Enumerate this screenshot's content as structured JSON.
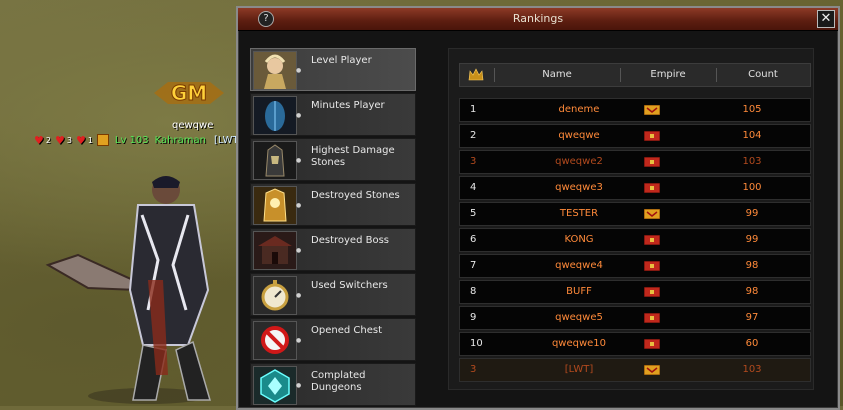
{
  "world": {
    "gm_badge": "GM",
    "player_name": "qewqwe",
    "hearts": [
      "2",
      "3",
      "1"
    ],
    "level_text": "Lv 103",
    "class_text": "Kahraman",
    "guild_text": "[LWT]"
  },
  "window": {
    "title": "Rankings",
    "help_label": "?",
    "close_label": "✕"
  },
  "categories": [
    {
      "label": "Level Player",
      "icon": "knight-portrait-icon",
      "active": true
    },
    {
      "label": "Minutes Player",
      "icon": "blue-feather-icon",
      "active": false
    },
    {
      "label": "Highest Damage Stones",
      "icon": "dark-stone-icon",
      "active": false
    },
    {
      "label": "Destroyed Stones",
      "icon": "golden-stone-icon",
      "active": false
    },
    {
      "label": "Destroyed Boss",
      "icon": "temple-icon",
      "active": false
    },
    {
      "label": "Used Switchers",
      "icon": "stopwatch-icon",
      "active": false
    },
    {
      "label": "Opened Chest",
      "icon": "forbidden-icon",
      "active": false
    },
    {
      "label": "Complated Dungeons",
      "icon": "teal-hexagon-icon",
      "active": false
    }
  ],
  "table": {
    "headers": {
      "rank": "crown-icon",
      "name": "Name",
      "empire": "Empire",
      "count": "Count"
    },
    "rows": [
      {
        "rank": "1",
        "name": "deneme",
        "empire": "yellow",
        "count": "105"
      },
      {
        "rank": "2",
        "name": "qweqwe",
        "empire": "red",
        "count": "104"
      },
      {
        "rank": "3",
        "name": "qweqwe2",
        "empire": "red",
        "count": "103"
      },
      {
        "rank": "4",
        "name": "qweqwe3",
        "empire": "red",
        "count": "100"
      },
      {
        "rank": "5",
        "name": "TESTER",
        "empire": "yellow",
        "count": "99"
      },
      {
        "rank": "6",
        "name": "KONG",
        "empire": "red",
        "count": "99"
      },
      {
        "rank": "7",
        "name": "qweqwe4",
        "empire": "red",
        "count": "98"
      },
      {
        "rank": "8",
        "name": "BUFF",
        "empire": "red",
        "count": "98"
      },
      {
        "rank": "9",
        "name": "qweqwe5",
        "empire": "red",
        "count": "97"
      },
      {
        "rank": "10",
        "name": "qweqwe10",
        "empire": "red",
        "count": "60"
      }
    ],
    "own_row": {
      "rank": "3",
      "name": "[LWT]",
      "empire": "yellow",
      "count": "103"
    }
  },
  "colors": {
    "title_bar": "#7a2a18",
    "name_text": "#ff8a3a",
    "dim_text": "#b24a1e",
    "empire_red": "#c0281c",
    "empire_yellow": "#e0a020"
  }
}
